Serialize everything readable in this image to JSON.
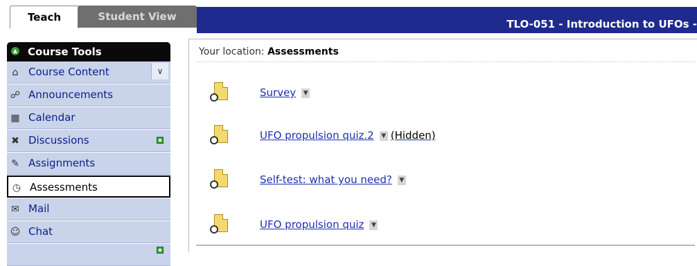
{
  "tabs": {
    "teach": "Teach",
    "student_view": "Student View"
  },
  "course_title": "TLO-051 - Introduction to UFOs -",
  "sidebar": {
    "header": "Course Tools",
    "items": [
      {
        "label": "Course Content",
        "icon": "home-icon"
      },
      {
        "label": "Announcements",
        "icon": "megaphone-icon"
      },
      {
        "label": "Calendar",
        "icon": "calendar-icon"
      },
      {
        "label": "Discussions",
        "icon": "pin-icon"
      },
      {
        "label": "Assignments",
        "icon": "assignment-icon"
      },
      {
        "label": "Assessments",
        "icon": "assessment-icon",
        "active": true
      },
      {
        "label": "Mail",
        "icon": "mail-icon"
      },
      {
        "label": "Chat",
        "icon": "chat-icon"
      }
    ]
  },
  "location": {
    "prefix": "Your location:",
    "current": "Assessments"
  },
  "assessments": [
    {
      "title": "Survey",
      "status": ""
    },
    {
      "title": "UFO propulsion quiz.2",
      "status": "(Hidden)"
    },
    {
      "title": "Self-test: what you need?",
      "status": ""
    },
    {
      "title": "UFO propulsion quiz",
      "status": ""
    }
  ],
  "colors": {
    "header_blue": "#1f2a8f",
    "sidebar_bg": "#c9d3ea",
    "link": "#1d2fb0",
    "new_indicator": "#3aa33a"
  }
}
